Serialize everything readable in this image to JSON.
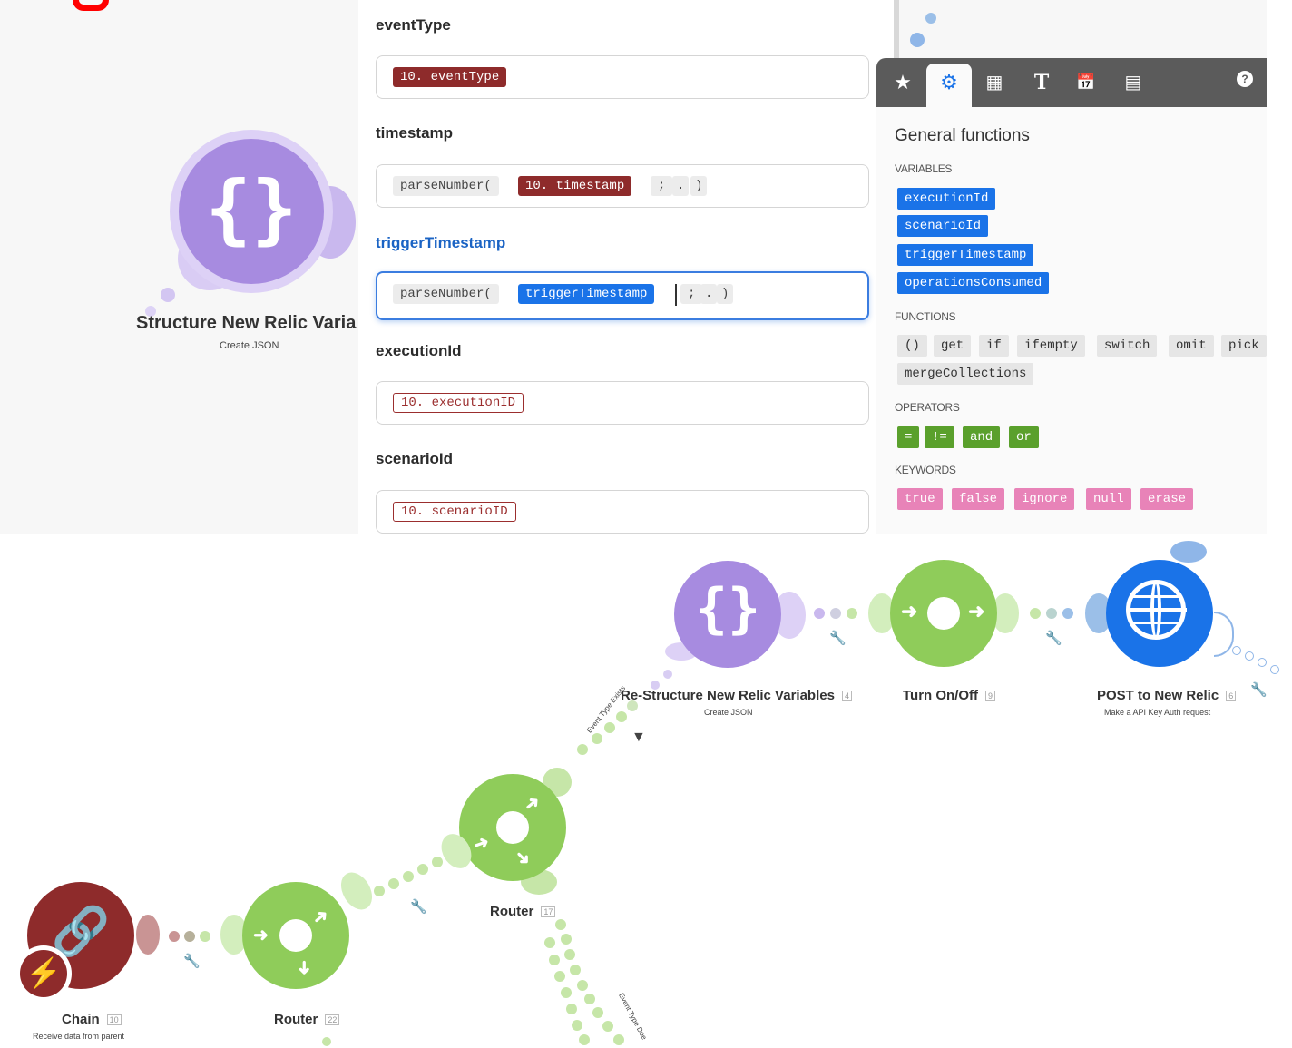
{
  "top_module": {
    "title": "Structure New Relic Varia",
    "subtitle": "Create JSON",
    "icon": "braces-icon"
  },
  "mapping": {
    "fields": [
      {
        "label": "eventType",
        "tokens": [
          "10. eventType"
        ]
      },
      {
        "label": "timestamp",
        "tokens": [
          "parseNumber(",
          "10. timestamp",
          ";",
          ".",
          ")"
        ]
      },
      {
        "label": "triggerTimestamp",
        "tokens": [
          "parseNumber(",
          "triggerTimestamp",
          ";",
          ".",
          ")"
        ]
      },
      {
        "label": "executionId",
        "tokens": [
          "10. executionID"
        ]
      },
      {
        "label": "scenarioId",
        "tokens": [
          "10. scenarioID"
        ]
      }
    ]
  },
  "functions_panel": {
    "toolbar_icons": [
      "star-icon",
      "gears-icon",
      "calculator-icon",
      "text-icon",
      "calendar-icon",
      "table-icon",
      "help-icon"
    ],
    "toolbar_glyphs": [
      "★",
      "⚙",
      "▦",
      "T",
      "📅",
      "▤",
      "?"
    ],
    "title": "General functions",
    "variables_heading": "VARIABLES",
    "variables": [
      "executionId",
      "scenarioId",
      "triggerTimestamp",
      "operationsConsumed"
    ],
    "functions_heading": "FUNCTIONS",
    "functions": [
      "()",
      "get",
      "if",
      "ifempty",
      "switch",
      "omit",
      "pick",
      "mergeCollections"
    ],
    "operators_heading": "OPERATORS",
    "operators": [
      "=",
      "!=",
      "and",
      "or"
    ],
    "keywords_heading": "KEYWORDS",
    "keywords": [
      "true",
      "false",
      "ignore",
      "null",
      "erase"
    ]
  },
  "flow": {
    "modules": [
      {
        "title": "Chain",
        "id": "10",
        "subtitle": "Receive data from parent"
      },
      {
        "title": "Router",
        "id": "22",
        "subtitle": ""
      },
      {
        "title": "Router",
        "id": "17",
        "subtitle": ""
      },
      {
        "title": "Re-Structure New Relic Variables",
        "id": "4",
        "subtitle": "Create JSON"
      },
      {
        "title": "Turn On/Off",
        "id": "9",
        "subtitle": ""
      },
      {
        "title": "POST to New Relic",
        "id": "6",
        "subtitle": "Make a API Key Auth request"
      }
    ],
    "routes": [
      "Event Type Exists",
      "Event Type Doe"
    ]
  },
  "colors": {
    "purple": "#a78be0",
    "green": "#8fcc5a",
    "blue": "#1a73e8",
    "chain_red": "#8e2b2b"
  }
}
